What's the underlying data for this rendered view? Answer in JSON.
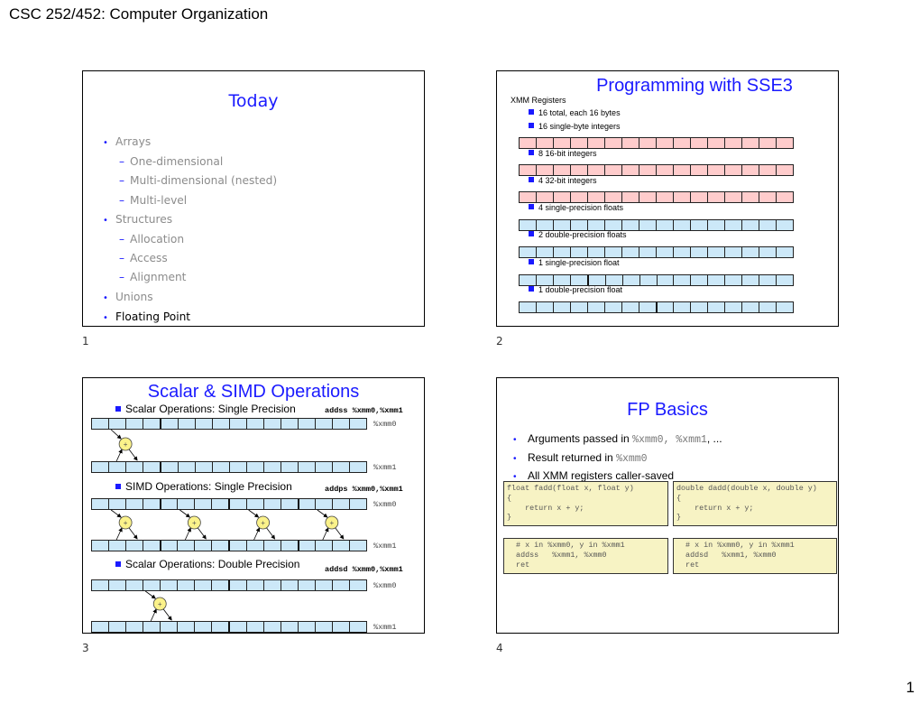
{
  "header": {
    "title": "CSC 252/452: Computer Organization",
    "page_number": "1"
  },
  "slides": [
    {
      "number": "1",
      "title": "Today",
      "items": [
        {
          "text": "Arrays",
          "level": 1,
          "active": false
        },
        {
          "text": "One-dimensional",
          "level": 2,
          "active": false
        },
        {
          "text": "Multi-dimensional (nested)",
          "level": 2,
          "active": false
        },
        {
          "text": "Multi-level",
          "level": 2,
          "active": false
        },
        {
          "text": "Structures",
          "level": 1,
          "active": false
        },
        {
          "text": "Allocation",
          "level": 2,
          "active": false
        },
        {
          "text": "Access",
          "level": 2,
          "active": false
        },
        {
          "text": "Alignment",
          "level": 2,
          "active": false
        },
        {
          "text": "Unions",
          "level": 1,
          "active": false
        },
        {
          "text": "Floating Point",
          "level": 1,
          "active": true
        }
      ]
    },
    {
      "number": "2",
      "title": "Programming with SSE3",
      "heading": "XMM Registers",
      "bullets": [
        "16 total, each 16 bytes",
        "16 single-byte integers",
        "8 16-bit integers",
        "4 32-bit integers",
        "4 single-precision floats",
        "2 double-precision floats",
        "1 single-precision float",
        "1 double-precision float"
      ],
      "registers": [
        {
          "color": "pink",
          "lanes": 16
        },
        {
          "color": "pink",
          "lanes": 8
        },
        {
          "color": "pink",
          "lanes": 4
        },
        {
          "color": "blue",
          "lanes": 4
        },
        {
          "color": "blue",
          "lanes": 2
        },
        {
          "color": "blue",
          "lanes": 1
        },
        {
          "color": "blue",
          "lanes": 1
        }
      ]
    },
    {
      "number": "3",
      "title": "Scalar & SIMD Operations",
      "operations": [
        {
          "label": "Scalar Operations: Single Precision",
          "instruction": "addss %xmm0,%xmm1",
          "src": "%xmm0",
          "dst": "%xmm1",
          "lanes": 1
        },
        {
          "label": "SIMD Operations: Single Precision",
          "instruction": "addps %xmm0,%xmm1",
          "src": "%xmm0",
          "dst": "%xmm1",
          "lanes": 4
        },
        {
          "label": "Scalar Operations: Double Precision",
          "instruction": "addsd %xmm0,%xmm1",
          "src": "%xmm0",
          "dst": "%xmm1",
          "lanes": 1
        }
      ],
      "adder_symbol": "+"
    },
    {
      "number": "4",
      "title": "FP Basics",
      "bullets": [
        {
          "pre": "Arguments passed in ",
          "code": "%xmm0, %xmm1",
          "post": ", ..."
        },
        {
          "pre": "Result returned in ",
          "code": "%xmm0",
          "post": ""
        },
        {
          "pre": "All XMM registers caller-saved",
          "code": "",
          "post": ""
        }
      ],
      "code_c_float": "float fadd(float x, float y)\n{\n    return x + y;\n}",
      "code_c_double": "double dadd(double x, double y)\n{\n    return x + y;\n}",
      "code_asm_float": "  # x in %xmm0, y in %xmm1\n  addss   %xmm1, %xmm0\n  ret",
      "code_asm_double": "  # x in %xmm0, y in %xmm1\n  addsd   %xmm1, %xmm0\n  ret"
    }
  ]
}
